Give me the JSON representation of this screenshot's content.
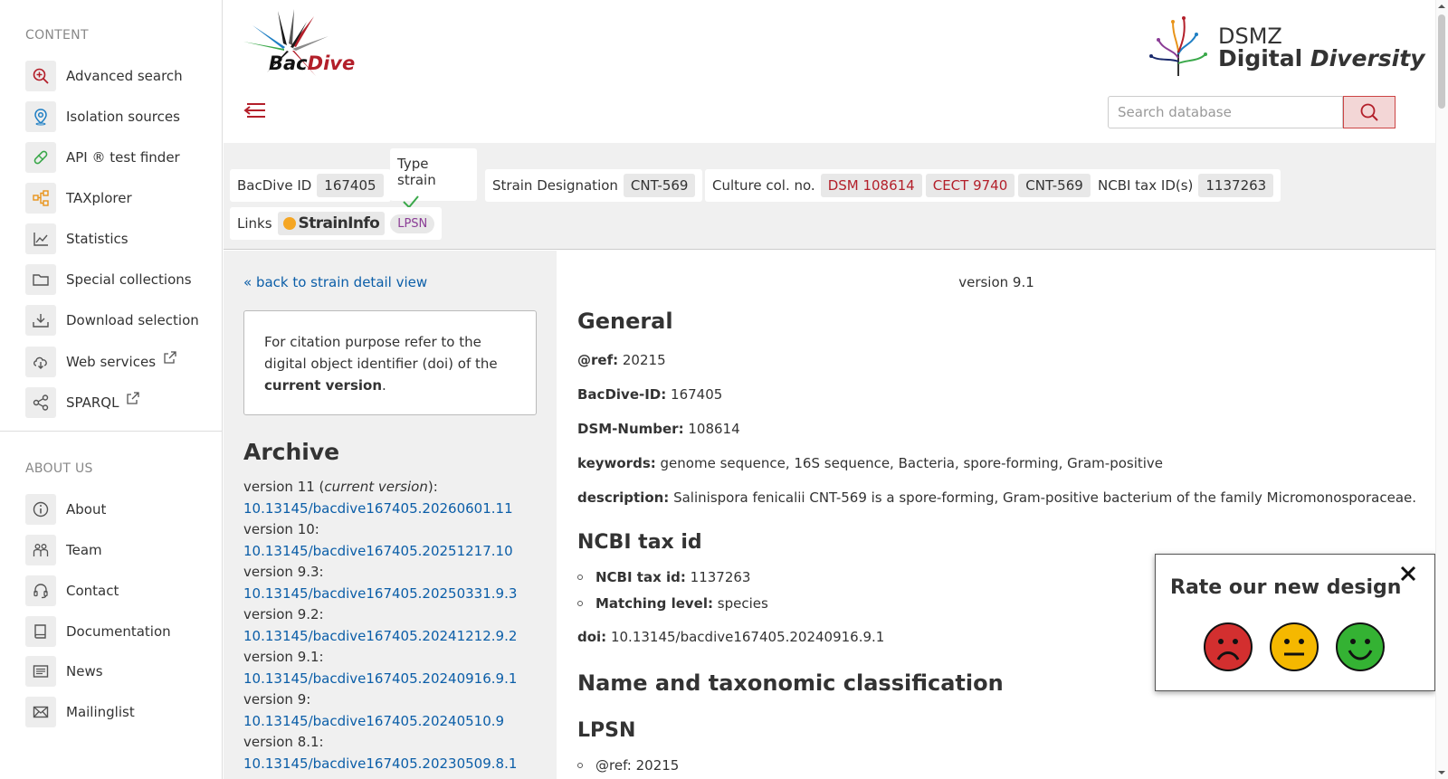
{
  "sidebar": {
    "content_title": "CONTENT",
    "content_items": [
      {
        "label": "Advanced search",
        "icon": "search-plus-icon"
      },
      {
        "label": "Isolation sources",
        "icon": "map-pin-icon"
      },
      {
        "label": "API ® test finder",
        "icon": "pill-icon"
      },
      {
        "label": "TAXplorer",
        "icon": "hierarchy-icon"
      },
      {
        "label": "Statistics",
        "icon": "line-chart-icon"
      },
      {
        "label": "Special collections",
        "icon": "folder-icon"
      },
      {
        "label": "Download selection",
        "icon": "download-icon"
      },
      {
        "label": "Web services",
        "icon": "cloud-download-icon"
      },
      {
        "label": "SPARQL",
        "icon": "share-nodes-icon"
      }
    ],
    "about_title": "ABOUT US",
    "about_items": [
      {
        "label": "About",
        "icon": "info-icon"
      },
      {
        "label": "Team",
        "icon": "team-icon"
      },
      {
        "label": "Contact",
        "icon": "headset-icon"
      },
      {
        "label": "Documentation",
        "icon": "book-icon"
      },
      {
        "label": "News",
        "icon": "newspaper-icon"
      },
      {
        "label": "Mailinglist",
        "icon": "envelope-icon"
      }
    ]
  },
  "header": {
    "logo_text_a": "Bac",
    "logo_text_b": "Dive",
    "dsmz_line1": "DSMZ",
    "dsmz_line2a": "Digital ",
    "dsmz_line2b": "Diversity",
    "search_placeholder": "Search database"
  },
  "infobar": {
    "bacdive_id_label": "BacDive ID",
    "bacdive_id": "167405",
    "type_strain_label": "Type strain",
    "strain_designation_label": "Strain Designation",
    "strain_designation": "CNT-569",
    "culture_label": "Culture col. no.",
    "culture_nos": [
      "DSM 108614",
      "CECT 9740",
      "CNT-569"
    ],
    "ncbi_label": "NCBI tax ID(s)",
    "ncbi_id": "1137263",
    "links_label": "Links",
    "straininfo": "StrainInfo",
    "lpsn": "LPSN"
  },
  "left": {
    "back_link": "« back to strain detail view",
    "cite_text_1": "For citation purpose refer to the digital object identifier (doi) of the ",
    "cite_bold": "current version",
    "cite_text_2": ".",
    "archive_title": "Archive",
    "versions": [
      {
        "label": "version 11 (",
        "italic": "current version",
        "suffix": "):",
        "doi": "10.13145/bacdive167405.20260601.11"
      },
      {
        "label": "version 10:",
        "italic": "",
        "suffix": "",
        "doi": "10.13145/bacdive167405.20251217.10"
      },
      {
        "label": "version 9.3:",
        "italic": "",
        "suffix": "",
        "doi": "10.13145/bacdive167405.20250331.9.3"
      },
      {
        "label": "version 9.2:",
        "italic": "",
        "suffix": "",
        "doi": "10.13145/bacdive167405.20241212.9.2"
      },
      {
        "label": "version 9.1:",
        "italic": "",
        "suffix": "",
        "doi": "10.13145/bacdive167405.20240916.9.1"
      },
      {
        "label": "version 9:",
        "italic": "",
        "suffix": "",
        "doi": "10.13145/bacdive167405.20240510.9"
      },
      {
        "label": "version 8.1:",
        "italic": "",
        "suffix": "",
        "doi": "10.13145/bacdive167405.20230509.8.1"
      }
    ]
  },
  "main": {
    "version": "version 9.1",
    "general_title": "General",
    "ref_label": "@ref:",
    "ref_value": "20215",
    "bacdive_id_label": "BacDive-ID:",
    "bacdive_id_value": "167405",
    "dsm_label": "DSM-Number:",
    "dsm_value": "108614",
    "keywords_label": "keywords:",
    "keywords_value": "genome sequence, 16S sequence, Bacteria, spore-forming, Gram-positive",
    "description_label": "description:",
    "description_value": "Salinispora fenicalii CNT-569 is a spore-forming, Gram-positive bacterium of the family Micromonosporaceae.",
    "ncbi_title": "NCBI tax id",
    "ncbi_tax_label": "NCBI tax id:",
    "ncbi_tax_value": "1137263",
    "matching_label": "Matching level:",
    "matching_value": "species",
    "doi_label": "doi:",
    "doi_value": "10.13145/bacdive167405.20240916.9.1",
    "taxonomy_title": "Name and taxonomic classification",
    "lpsn_title": "LPSN",
    "lpsn_ref_partial": "@ref: 20215"
  },
  "rating": {
    "title": "Rate our new design"
  },
  "colors": {
    "accent_red": "#b31f2a",
    "link_blue": "#0b5ea8",
    "panel_grey": "#f0f0f0"
  }
}
